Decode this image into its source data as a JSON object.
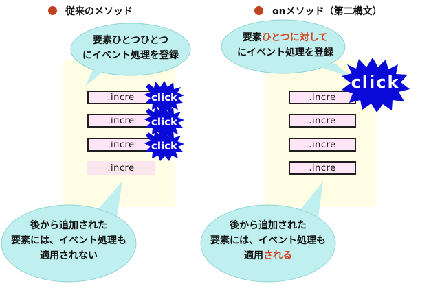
{
  "left": {
    "heading": "従来のメソッド",
    "top_bubble": {
      "line1": "要素ひとつひとつ",
      "line2": "にイベント処理を登録"
    },
    "items": [
      ".incre",
      ".incre",
      ".incre",
      ".incre"
    ],
    "click_label": "click",
    "bottom_bubble": {
      "line1": "後から追加された",
      "line2": "要素には、イベント処理も",
      "line3": "適用されない"
    }
  },
  "right": {
    "heading": "onメソッド（第二構文）",
    "top_bubble": {
      "line1_normal": "要素",
      "line1_highlight": "ひとつに対して",
      "line2": "にイベント処理を登録"
    },
    "items": [
      ".incre",
      ".incre",
      ".incre",
      ".incre"
    ],
    "click_label": "click",
    "bottom_bubble": {
      "line1": "後から追加された",
      "line2": "要素には、イベント処理も",
      "line3_normal": "適用",
      "line3_highlight": "される"
    }
  },
  "colors": {
    "bullet": "#c0401f",
    "bubble_fill": "#bff0ef",
    "burst_fill": "#0a0ad8",
    "highlight": "#d8411b",
    "panel": "#fffde3"
  }
}
